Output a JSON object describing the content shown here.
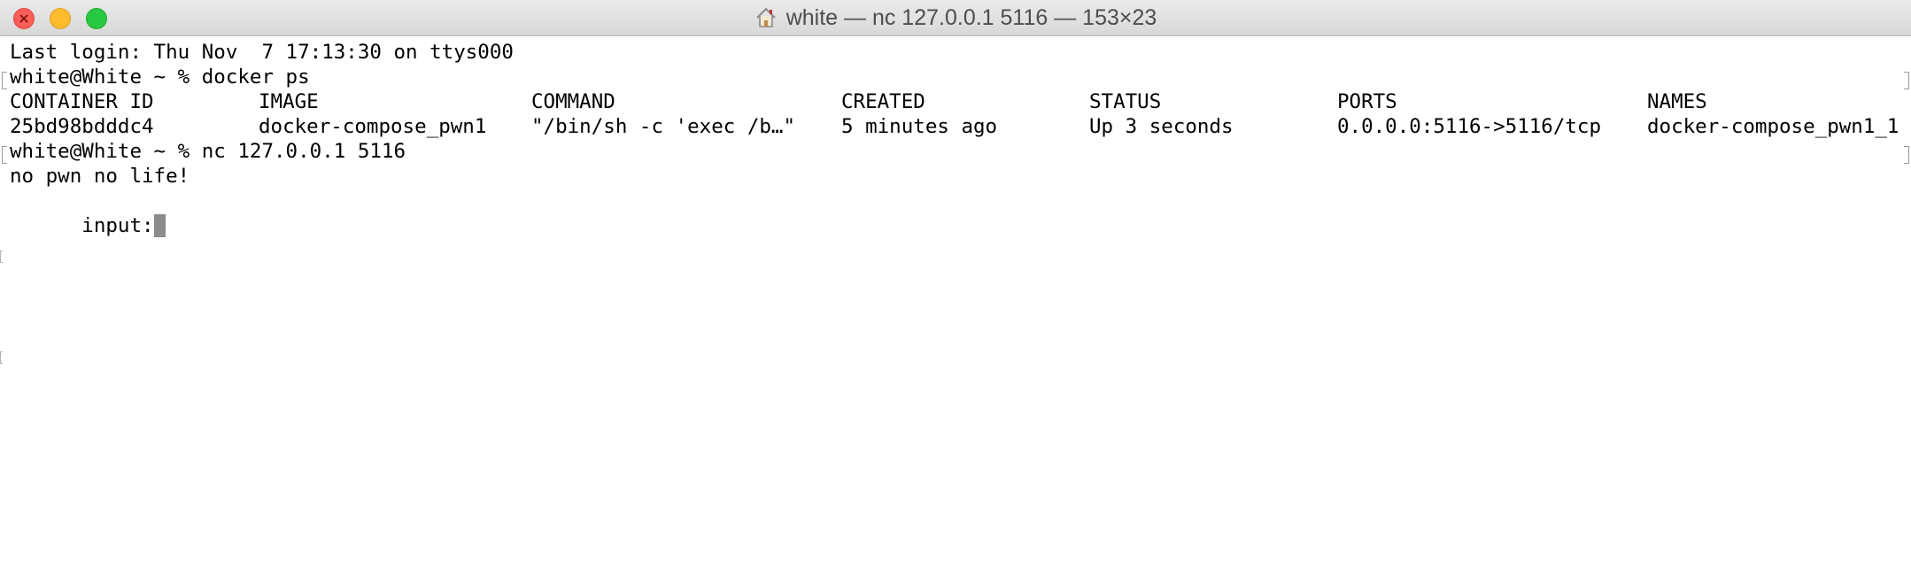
{
  "window": {
    "title": "white — nc 127.0.0.1 5116 — 153×23",
    "title_icon": "home-icon",
    "buttons": {
      "close": "close-button",
      "minimize": "minimize-button",
      "zoom": "zoom-button"
    },
    "colors": {
      "close": "#fc5f57",
      "minimize": "#fdbc2e",
      "zoom": "#28c840",
      "cursor": "#8c8c8c"
    }
  },
  "terminal": {
    "last_login": "Last login: Thu Nov  7 17:13:30 on ttys000",
    "prompt1": "white@White ~ % docker ps",
    "table": {
      "headers": {
        "container_id": "CONTAINER ID",
        "image": "IMAGE",
        "command": "COMMAND",
        "created": "CREATED",
        "status": "STATUS",
        "ports": "PORTS",
        "names": "NAMES"
      },
      "row": {
        "container_id": "25bd98bdddc4",
        "image": "docker-compose_pwn1",
        "command": "\"/bin/sh -c 'exec /b…\"",
        "created": "5 minutes ago",
        "status": "Up 3 seconds",
        "ports": "0.0.0.0:5116->5116/tcp",
        "names": "docker-compose_pwn1_1"
      }
    },
    "prompt2": "white@White ~ % nc 127.0.0.1 5116",
    "output1": "no pwn no life!",
    "input_prompt": "input:"
  }
}
